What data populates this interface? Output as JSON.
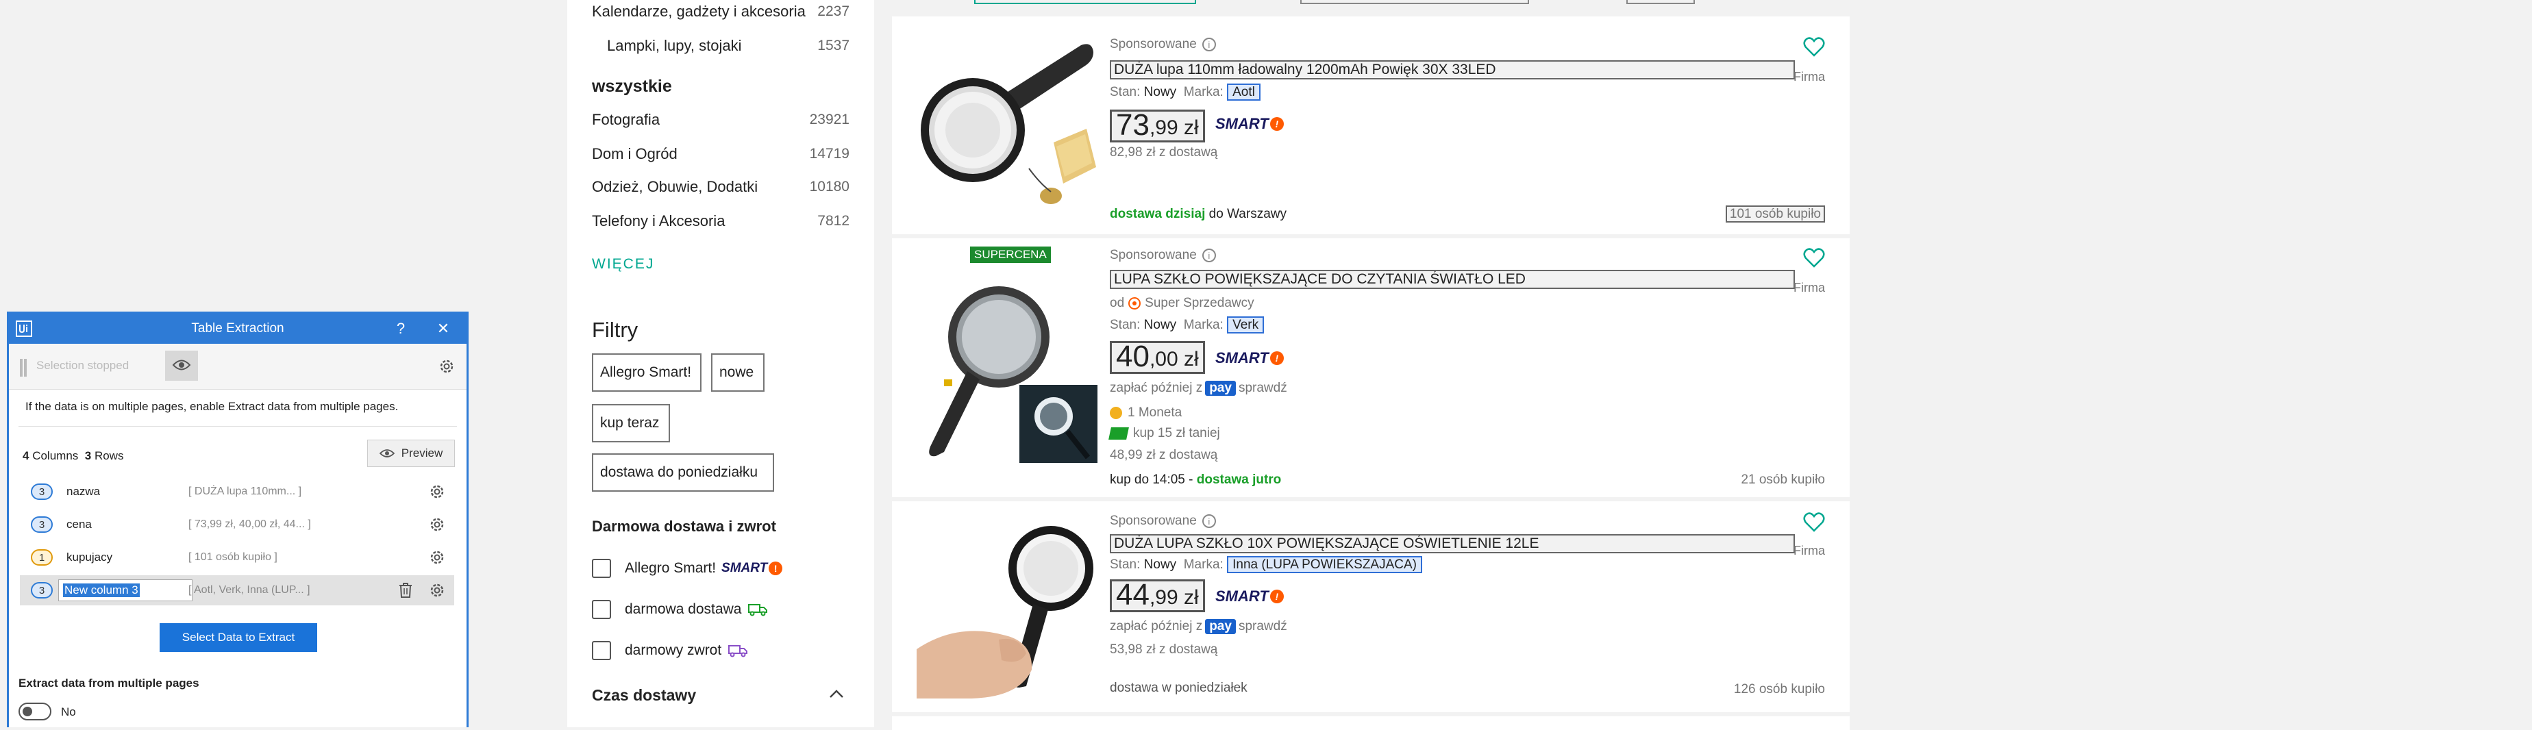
{
  "categories": {
    "sub_items": [
      {
        "label": "Kalendarze, gadżety i akcesoria",
        "count": "2237"
      },
      {
        "label": "Lampki, lupy, stojaki",
        "count": "1537"
      }
    ],
    "all_heading": "wszystkie",
    "all_items": [
      {
        "label": "Fotografia",
        "count": "23921"
      },
      {
        "label": "Dom i Ogród",
        "count": "14719"
      },
      {
        "label": "Odzież, Obuwie, Dodatki",
        "count": "10180"
      },
      {
        "label": "Telefony i Akcesoria",
        "count": "7812"
      }
    ],
    "more_label": "WIĘCEJ"
  },
  "filters": {
    "title": "Filtry",
    "chips": [
      "Allegro Smart!",
      "nowe",
      "kup teraz",
      "dostawa do poniedziałku"
    ],
    "free_delivery_heading": "Darmowa dostawa i zwrot",
    "checkboxes": [
      "Allegro Smart!",
      "darmowa dostawa",
      "darmowy zwrot"
    ],
    "smart_label": "SMART",
    "delivery_time_heading": "Czas dostawy"
  },
  "listings": [
    {
      "sponsored": "Sponsorowane",
      "title": "DUŻA lupa 110mm ładowalny 1200mAh Powięk 30X 33LED",
      "seller_type": "Firma",
      "condition_label": "Stan:",
      "condition_value": "Nowy",
      "brand_label": "Marka:",
      "brand_value": "Aotl",
      "price_int": "73",
      "price_dec": ",99 zł",
      "smart": "SMART",
      "with_delivery": "82,98 zł z dostawą",
      "delivery_green": "dostawa dzisiaj",
      "delivery_rest": " do Warszawy",
      "bought": "101 osób kupiło"
    },
    {
      "badge": "SUPERCENA",
      "sponsored": "Sponsorowane",
      "title": "LUPA SZKŁO POWIĘKSZAJĄCE DO CZYTANIA ŚWIATŁO LED",
      "seller_type": "Firma",
      "seller_prefix": "od",
      "seller_name": "Super Sprzedawcy",
      "condition_label": "Stan:",
      "condition_value": "Nowy",
      "brand_label": "Marka:",
      "brand_value": "Verk",
      "price_int": "40",
      "price_dec": ",00 zł",
      "smart": "SMART",
      "pay_later_prefix": "zapłać później z",
      "pay_label": "pay",
      "pay_check": "sprawdź",
      "coin": "1 Moneta",
      "cheaper": "kup 15 zł taniej",
      "with_delivery": "48,99 zł z dostawą",
      "order_by": "kup do 14:05 - ",
      "delivery_green": "dostawa jutro",
      "bought": "21 osób kupiło"
    },
    {
      "sponsored": "Sponsorowane",
      "title": "DUŻA LUPA SZKŁO 10X POWIĘKSZAJĄCE OŚWIETLENIE 12LE",
      "seller_type": "Firma",
      "condition_label": "Stan:",
      "condition_value": "Nowy",
      "brand_label": "Marka:",
      "brand_value": "Inna (LUPA POWIEKSZAJACA)",
      "price_int": "44",
      "price_dec": ",99 zł",
      "smart": "SMART",
      "pay_later_prefix": "zapłać później z",
      "pay_label": "pay",
      "pay_check": "sprawdź",
      "with_delivery": "53,98 zł z dostawą",
      "delivery": "dostawa w poniedziałek",
      "bought": "126 osób kupiło"
    }
  ],
  "dialog": {
    "title": "Table Extraction",
    "help": "?",
    "close": "✕",
    "status_placeholder": "Selection stopped",
    "info": "If the data is on multiple pages, enable Extract data from multiple pages.",
    "columns_count": "4",
    "columns_label": "Columns",
    "rows_count": "3",
    "rows_label": "Rows",
    "preview_label": "Preview",
    "columns": [
      {
        "badge": "3",
        "name": "nazwa",
        "preview": "[ DUŻA lupa 110mm... ]"
      },
      {
        "badge": "3",
        "name": "cena",
        "preview": "[ 73,99 zł, 40,00 zł, 44... ]"
      },
      {
        "badge": "1",
        "name": "kupujacy",
        "preview": "[ 101 osób kupiło ]"
      },
      {
        "badge": "3",
        "name": "New column 3",
        "preview": "[ Aotl, Verk, Inna (LUP... ]"
      }
    ],
    "select_button": "Select Data to Extract",
    "multi_label": "Extract data from multiple pages",
    "toggle_value": "No"
  }
}
